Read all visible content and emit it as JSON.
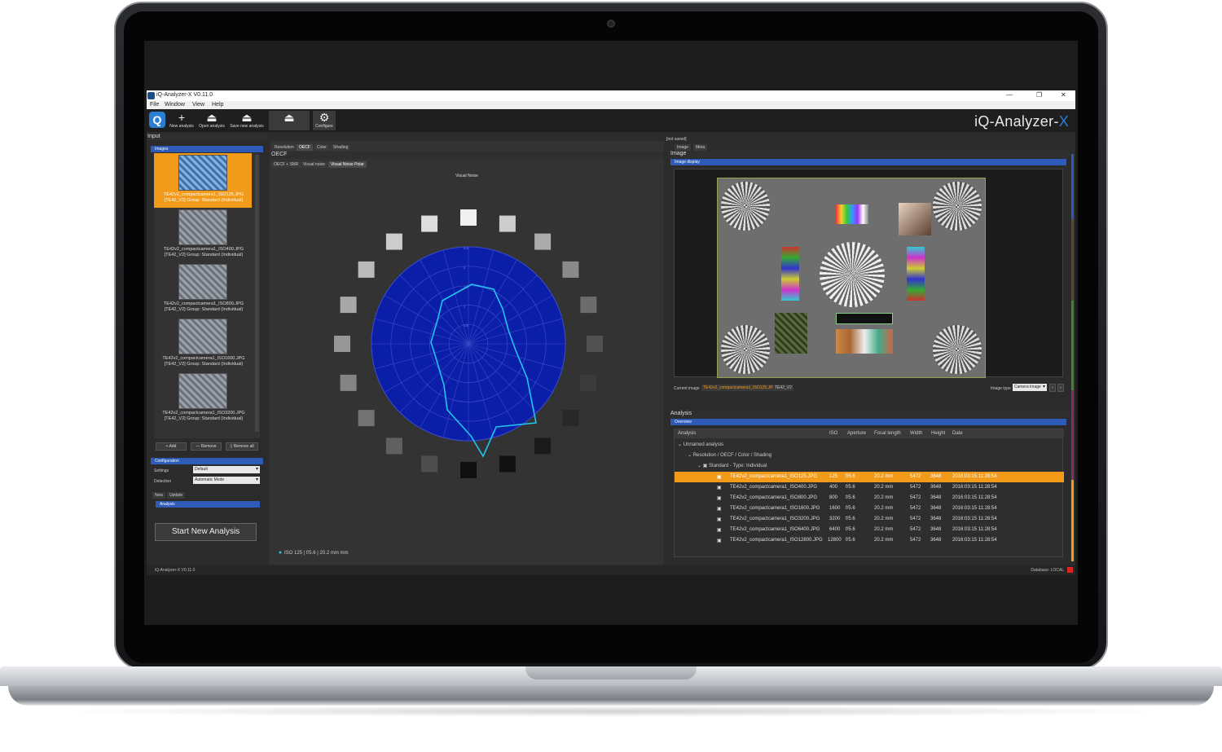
{
  "window": {
    "title": "iQ-Analyzer-X V0.11.0",
    "controls": [
      "—",
      "❐",
      "✕"
    ]
  },
  "menu": [
    "File",
    "Window",
    "View",
    "Help"
  ],
  "toolbar": {
    "new_label": "New analysis",
    "open_label": "Open analysis",
    "save_label": "Save new analysis",
    "configure_label": "Configure",
    "brand_main": "iQ-Analyzer-",
    "brand_x": "X"
  },
  "input": {
    "title": "Input",
    "images_header": "Images",
    "thumbnails": [
      {
        "file": "TE42v2_compactcamera1_ISO125.JPG",
        "group": "[TE42_V2] Group: Standard (Individual)",
        "selected": true
      },
      {
        "file": "TE42v2_compactcamera1_ISO400.JPG",
        "group": "[TE42_V2] Group: Standard (Individual)",
        "selected": false
      },
      {
        "file": "TE42v2_compactcamera1_ISO800.JPG",
        "group": "[TE42_V2] Group: Standard (Individual)",
        "selected": false
      },
      {
        "file": "TE42v2_compactcamera1_ISO1600.JPG",
        "group": "[TE42_V2] Group: Standard (Individual)",
        "selected": false
      },
      {
        "file": "TE42v2_compactcamera1_ISO3200.JPG",
        "group": "[TE42_V2] Group: Standard (Individual)",
        "selected": false
      }
    ],
    "add_label": "Add",
    "remove_label": "Remove",
    "remove_all_label": "Remove all",
    "configuration_header": "Configuration",
    "settings_label": "Settings",
    "settings_value": "Default",
    "detection_label": "Detection",
    "detection_value": "Automatic Mode",
    "tab_new": "New",
    "tab_update": "Update",
    "analysis_header": "Analysis",
    "start_label": "Start New Analysis"
  },
  "center": {
    "tabs": [
      "Resolution",
      "OECF",
      "Color",
      "Shading"
    ],
    "section_title": "OECF",
    "subtabs": [
      "OECF + SNR",
      "Visual noise",
      "Visual Noise Polar"
    ],
    "plot_title": "Visual Noise",
    "legend": "ISO 125 | f/5.6 | 20.2 mm mm",
    "ring_labels": [
      "2.5",
      "2",
      "1.5",
      "1",
      "0.5"
    ]
  },
  "image_panel": {
    "not_saved": "[not saved]",
    "tabs": [
      "Image",
      "Meta"
    ],
    "title": "Image",
    "display_header": "Image display",
    "current_image_label": "Current image",
    "current_image_value": "TE42v2_compactcamera1_ISO125.JPG",
    "chart_tag": "TE42_V2",
    "image_type_label": "Image type",
    "image_type_value": "Camera image"
  },
  "analysis": {
    "title": "Analysis",
    "overview_header": "Overview",
    "columns": [
      "Analysis",
      "ISO",
      "Aperture",
      "Focal length",
      "Width",
      "Height",
      "Date"
    ],
    "tree": [
      "Unnamed analysis",
      "Resolution / OECF / Color / Shading",
      "Standard - Type: Individual"
    ],
    "rows": [
      {
        "file": "TE42v2_compactcamera1_ISO125.JPG",
        "iso": "125",
        "aperture": "f/5.6",
        "focal": "20.2 mm",
        "width": "5472",
        "height": "3648",
        "date": "2016:03:15 11:28:54",
        "selected": true
      },
      {
        "file": "TE42v2_compactcamera1_ISO400.JPG",
        "iso": "400",
        "aperture": "f/5.6",
        "focal": "20.2 mm",
        "width": "5472",
        "height": "3648",
        "date": "2016:03:15 11:28:54",
        "selected": false
      },
      {
        "file": "TE42v2_compactcamera1_ISO800.JPG",
        "iso": "800",
        "aperture": "f/5.6",
        "focal": "20.2 mm",
        "width": "5472",
        "height": "3648",
        "date": "2016:03:15 11:28:54",
        "selected": false
      },
      {
        "file": "TE42v2_compactcamera1_ISO1600.JPG",
        "iso": "1600",
        "aperture": "f/5.6",
        "focal": "20.2 mm",
        "width": "5472",
        "height": "3648",
        "date": "2016:03:15 11:28:54",
        "selected": false
      },
      {
        "file": "TE42v2_compactcamera1_ISO3200.JPG",
        "iso": "3200",
        "aperture": "f/5.6",
        "focal": "20.2 mm",
        "width": "5472",
        "height": "3648",
        "date": "2016:03:15 11:28:54",
        "selected": false
      },
      {
        "file": "TE42v2_compactcamera1_ISO6400.JPG",
        "iso": "6400",
        "aperture": "f/5.6",
        "focal": "20.2 mm",
        "width": "5472",
        "height": "3648",
        "date": "2016:03:15 11:28:54",
        "selected": false
      },
      {
        "file": "TE42v2_compactcamera1_ISO12800.JPG",
        "iso": "12800",
        "aperture": "f/5.6",
        "focal": "20.2 mm",
        "width": "5472",
        "height": "3648",
        "date": "2016:03:15 11:28:54",
        "selected": false
      }
    ]
  },
  "status": {
    "left": "iQ-Analyzer-X V0.11.0",
    "right": "Database: LOCAL"
  },
  "colors": {
    "accent": "#2a7fd4",
    "selection": "#f29a1a",
    "polar_fill": "#0a1ea8",
    "polar_line": "#21c4f0"
  }
}
